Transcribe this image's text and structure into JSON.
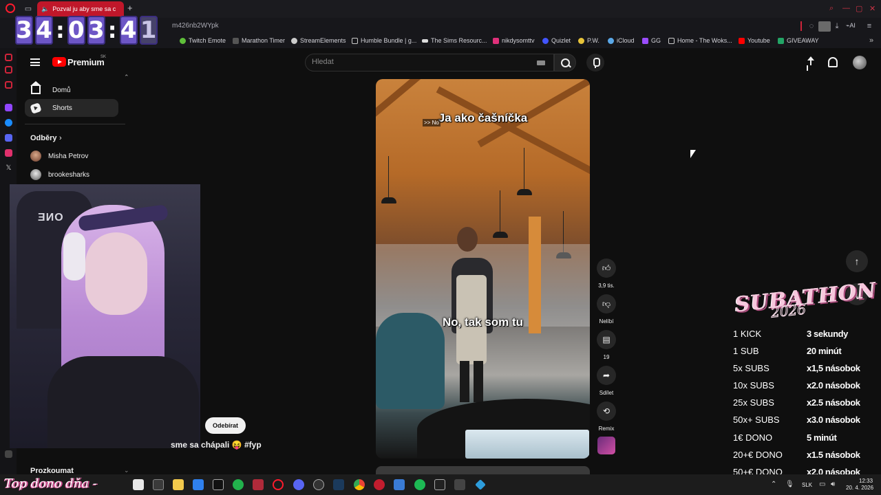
{
  "browser": {
    "active_tab_title": "Pozval ju aby sme sa c",
    "url_fragment": "m426nb2WYpk",
    "bookmarks": [
      {
        "label": "Twitch Emote",
        "color": "#5fbf3a"
      },
      {
        "label": "Marathon Timer",
        "color": "#888888"
      },
      {
        "label": "StreamElements",
        "color": "#dddddd"
      },
      {
        "label": "Humble Bundle | g...",
        "color": "#cccccc"
      },
      {
        "label": "The Sims Resourc...",
        "color": "#dddddd"
      },
      {
        "label": "nikdysomttv",
        "color": "#e0307a"
      },
      {
        "label": "Quizlet",
        "color": "#4255ff"
      },
      {
        "label": "P.W.",
        "color": "#e8c43a"
      },
      {
        "label": "iCloud",
        "color": "#5aa8e8"
      },
      {
        "label": "GG",
        "color": "#9b4dff"
      },
      {
        "label": "Home - The Woks...",
        "color": "#dddddd"
      },
      {
        "label": "Youtube",
        "color": "#ff0000"
      },
      {
        "label": "GIVEAWAY",
        "color": "#23a566"
      }
    ],
    "extras_label": "AI"
  },
  "youtube": {
    "brand": "Premium",
    "country_code": "SK",
    "search": {
      "placeholder": "Hledat",
      "value": ""
    },
    "nav": {
      "home": "Domů",
      "shorts": "Shorts"
    },
    "subscriptions": {
      "heading": "Odběry",
      "channels": [
        {
          "name": "Misha Petrov"
        },
        {
          "name": "brookesharks"
        }
      ]
    },
    "explore_heading": "Prozkoumat",
    "short": {
      "caption_top_arrows": ">> No",
      "caption_top": "Ja ako čašníčka",
      "caption_mid": "No, tak som tu",
      "title": "sme sa chápali 😝 #fyp",
      "subscribe_label": "Odebírat",
      "likes": "3,9 tis.",
      "dislike_label": "Nelíbí",
      "comments": "19",
      "share_label": "Sdílet",
      "remix_label": "Remix"
    }
  },
  "overlay": {
    "timer": [
      "3",
      "4",
      ":",
      "0",
      "3",
      ":",
      "4",
      "1"
    ],
    "subathon_title": "SUBATHON",
    "subathon_year": "2026",
    "rules": [
      {
        "trigger": "1 KICK",
        "reward": "3 sekundy"
      },
      {
        "trigger": "1 SUB",
        "reward": "20 minút"
      },
      {
        "trigger": "5x SUBS",
        "reward": "x1,5 násobok"
      },
      {
        "trigger": "10x SUBS",
        "reward": "x2.0 násobok"
      },
      {
        "trigger": "25x SUBS",
        "reward": "x2.5 násobok"
      },
      {
        "trigger": "50x+ SUBS",
        "reward": "x3.0 násobok"
      },
      {
        "trigger": "1€ DONO",
        "reward": "5 minút"
      },
      {
        "trigger": "20+€ DONO",
        "reward": "x1.5 násobok"
      },
      {
        "trigger": "50+€ DONO",
        "reward": "x2.0 násobok"
      }
    ],
    "top_dono": "Top dono dňa -"
  },
  "taskbar": {
    "language": "SLK",
    "time": "12:33",
    "date": "20. 4. 2026",
    "apps": [
      "file-icon",
      "calculator-icon",
      "folder-icon",
      "store-icon",
      "terminal-icon",
      "xbox-icon",
      "media-icon",
      "opera-icon",
      "discord-icon",
      "steam-icon-1",
      "steam-icon-2",
      "chrome-icon",
      "app-icon",
      "app-icon-2",
      "spotify-icon",
      "terminal-2-icon",
      "calc-icon",
      "app-icon-3"
    ]
  }
}
